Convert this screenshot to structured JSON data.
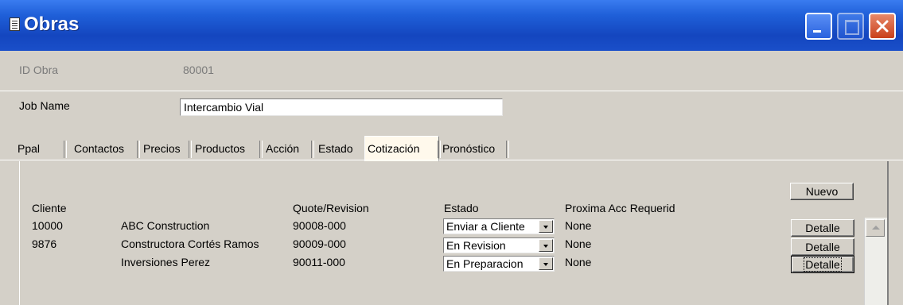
{
  "window": {
    "title": "Obras",
    "icon": "document-icon"
  },
  "header": {
    "id_label": "ID Obra",
    "id_value": "80001",
    "job_label": "Job Name",
    "job_value": "Intercambio Vial"
  },
  "tabs": [
    "Ppal",
    "Contactos",
    "Precios",
    "Productos",
    "Acción",
    "Estado",
    "Cotización",
    "Pronóstico"
  ],
  "active_tab": "Cotización",
  "table": {
    "headers": {
      "cliente": "Cliente",
      "quote": "Quote/Revision",
      "estado": "Estado",
      "accion": "Proxima Acc Requerid"
    },
    "rows": [
      {
        "id": "10000",
        "name": "ABC Construction",
        "quote": "90008-000",
        "estado": "Enviar a Cliente",
        "accion": "None",
        "button": "Detalle"
      },
      {
        "id": "9876",
        "name": "Constructora Cortés Ramos",
        "quote": "90009-000",
        "estado": "En Revision",
        "accion": "None",
        "button": "Detalle"
      },
      {
        "id": "",
        "name": "Inversiones Perez",
        "quote": "90011-000",
        "estado": "En Preparacion",
        "accion": "None",
        "button": "Detalle"
      }
    ]
  },
  "buttons": {
    "nuevo": "Nuevo"
  }
}
